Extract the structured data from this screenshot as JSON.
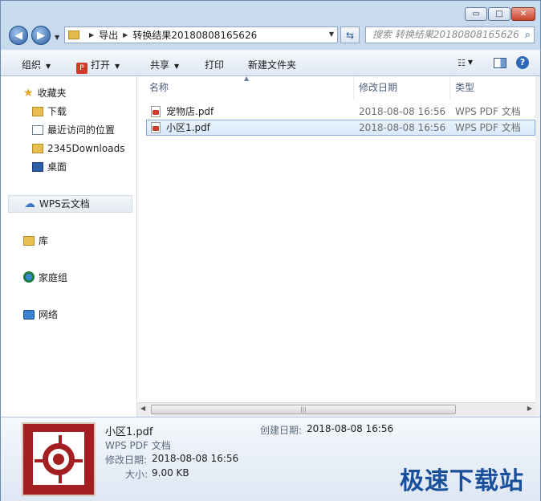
{
  "window": {
    "controls": {
      "minimize": "▭",
      "maximize": "□",
      "close": "✕"
    }
  },
  "navbar": {
    "back_icon": "back-arrow-icon",
    "forward_icon": "forward-arrow-icon",
    "breadcrumb": [
      "导出",
      "转换结果20180808165626"
    ],
    "search_placeholder": "搜索 转换结果20180808165626"
  },
  "toolbar": {
    "organize": "组织",
    "open": "打开",
    "share": "共享",
    "print": "打印",
    "new_folder": "新建文件夹"
  },
  "sidebar": {
    "favorites": "收藏夹",
    "favorite_items": [
      "下载",
      "最近访问的位置",
      "2345Downloads",
      "桌面"
    ],
    "wps_cloud": "WPS云文档",
    "libraries": "库",
    "homegroup": "家庭组",
    "network": "网络"
  },
  "columns": {
    "name": "名称",
    "modified": "修改日期",
    "type": "类型"
  },
  "files": [
    {
      "name": "宠物店.pdf",
      "modified": "2018-08-08 16:56",
      "type": "WPS PDF 文档",
      "selected": false
    },
    {
      "name": "小区1.pdf",
      "modified": "2018-08-08 16:56",
      "type": "WPS PDF 文档",
      "selected": true
    }
  ],
  "details": {
    "file_name": "小区1.pdf",
    "file_type": "WPS PDF 文档",
    "modified_label": "修改日期:",
    "modified_value": "2018-08-08 16:56",
    "size_label": "大小:",
    "size_value": "9.00 KB",
    "created_label": "创建日期:",
    "created_value": "2018-08-08 16:56"
  },
  "watermark": "极速下载站",
  "colors": {
    "accent": "#2c5c9c",
    "selection": "#d9e9fb",
    "pdf_red": "#a31f22"
  }
}
